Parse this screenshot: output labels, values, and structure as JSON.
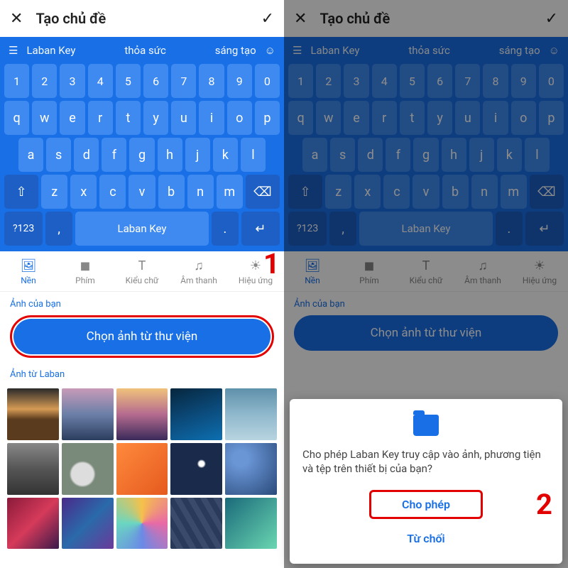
{
  "topbar": {
    "title": "Tạo chủ đề"
  },
  "kb_suggest": {
    "brand": "Laban Key",
    "w1": "thỏa sức",
    "w2": "sáng tạo"
  },
  "rows": {
    "num": [
      "1",
      "2",
      "3",
      "4",
      "5",
      "6",
      "7",
      "8",
      "9",
      "0"
    ],
    "r2": [
      "q",
      "w",
      "e",
      "r",
      "t",
      "y",
      "u",
      "i",
      "o",
      "p"
    ],
    "r3": [
      "a",
      "s",
      "d",
      "f",
      "g",
      "h",
      "j",
      "k",
      "l"
    ],
    "r4": [
      "z",
      "x",
      "c",
      "v",
      "b",
      "n",
      "m"
    ],
    "sym": "?123",
    "space": "Laban Key"
  },
  "tabs": [
    {
      "label": "Nền",
      "icon": "🖼"
    },
    {
      "label": "Phím",
      "icon": "◼"
    },
    {
      "label": "Kiểu chữ",
      "icon": "T"
    },
    {
      "label": "Âm thanh",
      "icon": "♫"
    },
    {
      "label": "Hiệu ứng",
      "icon": "☀"
    }
  ],
  "sections": {
    "your_photos": "Ảnh của bạn",
    "choose_btn": "Chọn ảnh từ thư viện",
    "laban_photos": "Ảnh từ Laban"
  },
  "dialog": {
    "message": "Cho phép Laban Key truy cập vào ảnh, phương tiện và tệp trên thiết bị của bạn?",
    "allow": "Cho phép",
    "deny": "Từ chối"
  },
  "callouts": {
    "one": "1",
    "two": "2"
  }
}
